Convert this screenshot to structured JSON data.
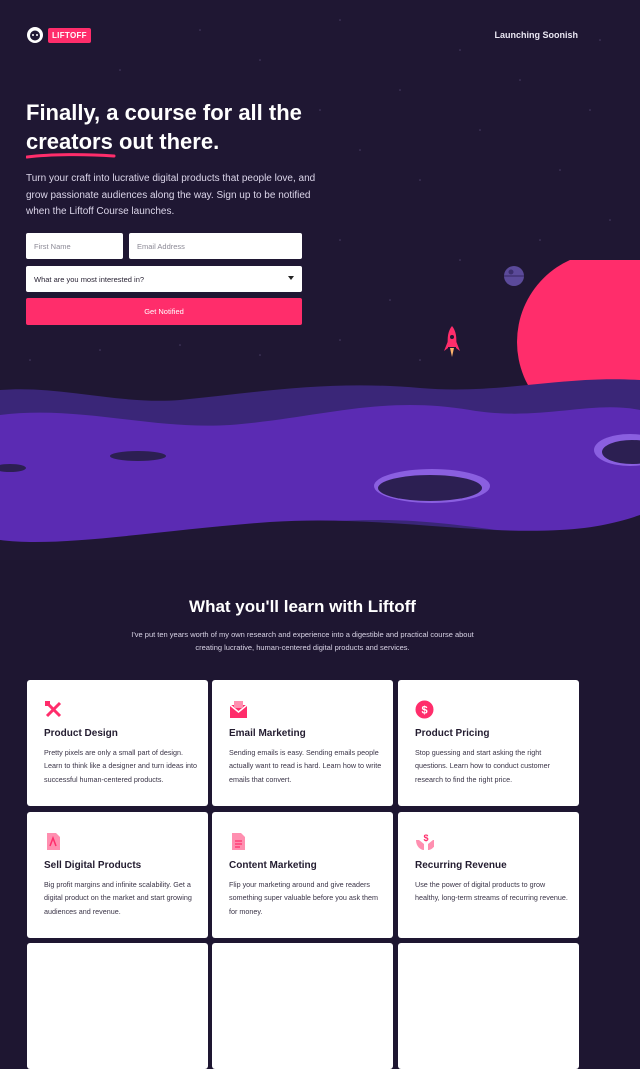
{
  "brand": {
    "logo_text": "LIFTOFF"
  },
  "nav": {
    "launch_link": "Launching Soonish"
  },
  "hero": {
    "title_line1": "Finally, a course for all the",
    "title_line2_a": "creators",
    "title_line2_b": " out there.",
    "body": "Turn your craft into lucrative digital products that people love, and grow passionate audiences along the way. Sign up to be notified when the Liftoff Course launches."
  },
  "form": {
    "first_name_placeholder": "First Name",
    "email_placeholder": "Email Address",
    "interest_select": "What are you most interested in?",
    "submit_label": "Get Notified"
  },
  "learn": {
    "title": "What you'll learn with Liftoff",
    "subtitle": "I've put ten years worth of my own research and experience into a digestible and practical course about creating lucrative, human-centered digital products and services."
  },
  "cards": [
    {
      "title": "Product Design",
      "desc": "Pretty pixels are only a small part of design. Learn to think like a designer and turn ideas into successful human-centered products.",
      "icon": "design-tools-icon"
    },
    {
      "title": "Email Marketing",
      "desc": "Sending emails is easy. Sending emails people actually want to read is hard. Learn how to write emails that convert.",
      "icon": "envelope-icon"
    },
    {
      "title": "Product Pricing",
      "desc": "Stop guessing and start asking the right questions. Learn how to conduct customer research to find the right price.",
      "icon": "dollar-icon"
    },
    {
      "title": "Sell Digital Products",
      "desc": "Big profit margins and infinite scalability. Get a digital product on the market and start growing audiences and revenue.",
      "icon": "pdf-file-icon"
    },
    {
      "title": "Content Marketing",
      "desc": "Flip your marketing around and give readers something super valuable before you ask them for money.",
      "icon": "document-icon"
    },
    {
      "title": "Recurring Revenue",
      "desc": "Use the power of digital products to grow healthy, long-term streams of recurring revenue.",
      "icon": "hands-dollar-icon"
    }
  ],
  "colors": {
    "accent": "#ff2d6b",
    "background": "#1e1631",
    "planet": "#ff2d6b",
    "terrain": "#5b2bb3"
  }
}
